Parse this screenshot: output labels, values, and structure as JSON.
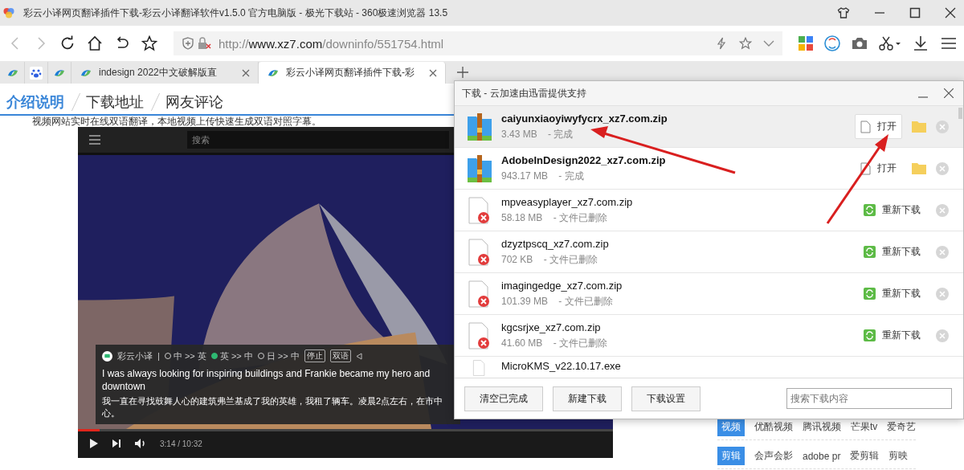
{
  "window": {
    "title": "彩云小译网页翻译插件下载-彩云小译翻译软件v1.5.0 官方电脑版 - 极光下载站 - 360极速浏览器 13.5"
  },
  "navigation": {
    "back_disabled": true,
    "forward_disabled": true
  },
  "address_bar": {
    "scheme": "http://",
    "host": "www.xz7.com",
    "path": "/downinfo/551754.html"
  },
  "tabs": [
    {
      "kind": "pinned",
      "selected": false
    },
    {
      "kind": "paw",
      "selected": false
    },
    {
      "kind": "pinned",
      "selected": false
    },
    {
      "kind": "page",
      "label": "indesign 2022中文破解版直",
      "selected": false
    },
    {
      "kind": "page",
      "label": "彩云小译网页翻译插件下载-彩",
      "selected": true
    }
  ],
  "page_tabs": [
    {
      "label": "介绍说明",
      "selected": true
    },
    {
      "label": "下载地址",
      "selected": false
    },
    {
      "label": "网友评论",
      "selected": false
    }
  ],
  "intro_text": "视频网站实时在线双语翻译，本地视频上传快速生成双语对照字幕。",
  "video": {
    "search_placeholder": "搜索",
    "time": "3:14 / 10:32",
    "level": 0.04,
    "subtitle": {
      "app_name": "彩云小译",
      "separator": "|",
      "modes": [
        {
          "label": "中 >> 英",
          "selected": false
        },
        {
          "label": "英 >> 中",
          "selected": true
        },
        {
          "label": "日 >> 中",
          "selected": false
        }
      ],
      "buttons": [
        "停止",
        "双语"
      ],
      "english": "I was always looking for inspiring buildings and Frankie became my hero and downtown",
      "chinese": "我一直在寻找鼓舞人心的建筑弗兰基成了我的英雄，我租了辆车。凌晨2点左右，在市中心。"
    }
  },
  "links": [
    {
      "tag": "视频",
      "items": [
        "优酷视频",
        "腾讯视频",
        "芒果tv",
        "爱奇艺"
      ]
    },
    {
      "tag": "剪辑",
      "items": [
        "会声会影",
        "adobe pr",
        "爱剪辑",
        "剪映"
      ]
    }
  ],
  "download_dialog": {
    "title": "下载 - 云加速由迅雷提供支持",
    "items": [
      {
        "kind": "done",
        "name": "caiyunxiaoyiwyfycrx_xz7.com.zip",
        "size": "3.43 MB",
        "status": "- 完成",
        "action": "打开",
        "selected": true
      },
      {
        "kind": "done",
        "name": "AdobeInDesign2022_xz7.com.zip",
        "size": "943.17 MB",
        "status": "- 完成",
        "action": "打开",
        "selected": false
      },
      {
        "kind": "deleted",
        "name": "mpveasyplayer_xz7.com.zip",
        "size": "58.18 MB",
        "status": "- 文件已删除",
        "action": "重新下载",
        "selected": false
      },
      {
        "kind": "deleted",
        "name": "dzyztpscq_xz7.com.zip",
        "size": "702 KB",
        "status": "- 文件已删除",
        "action": "重新下载",
        "selected": false
      },
      {
        "kind": "deleted",
        "name": "imagingedge_xz7.com.zip",
        "size": "101.39 MB",
        "status": "- 文件已删除",
        "action": "重新下载",
        "selected": false
      },
      {
        "kind": "deleted",
        "name": "kgcsrjxe_xz7.com.zip",
        "size": "41.60 MB",
        "status": "- 文件已删除",
        "action": "重新下载",
        "selected": false
      },
      {
        "kind": "partial",
        "name": "MicroKMS_v22.10.17.exe",
        "selected": false
      }
    ],
    "buttons": [
      "清空已完成",
      "新建下载",
      "下载设置"
    ],
    "search": {
      "placeholder": "搜索下载内容"
    }
  }
}
